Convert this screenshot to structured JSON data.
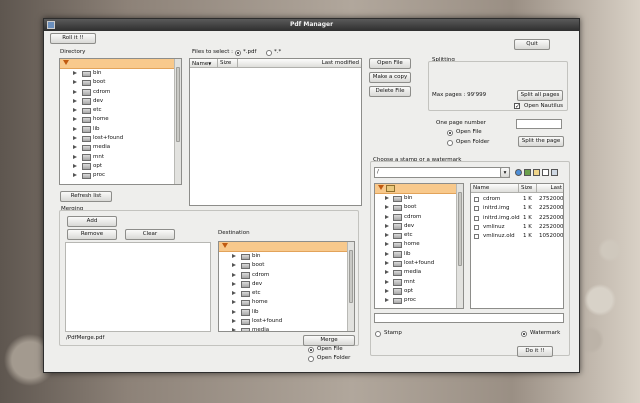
{
  "window": {
    "title": "Pdf Manager"
  },
  "toolbar": {
    "roll_label": "Roll it !!",
    "quit_label": "Quit"
  },
  "directory": {
    "label": "Directory",
    "items": [
      "bin",
      "boot",
      "cdrom",
      "dev",
      "etc",
      "home",
      "lib",
      "lost+found",
      "media",
      "mnt",
      "opt",
      "proc"
    ],
    "refresh_label": "Refresh list"
  },
  "files": {
    "select_label": "Files to select :",
    "options": [
      {
        "label": "*.pdf",
        "selected": true
      },
      {
        "label": "*.*",
        "selected": false
      }
    ],
    "columns": [
      "Name",
      "Size",
      "Last modified"
    ],
    "open_file_label": "Open File",
    "make_copy_label": "Make a copy",
    "delete_file_label": "Delete File"
  },
  "splitting": {
    "label": "Splitting",
    "max_pages": "Max pages : 99'999",
    "split_all_label": "Split all pages",
    "open_nautilus_label": "Open Nautilus",
    "open_nautilus_checked": true,
    "one_page_label": "One page number",
    "page_number_value": "",
    "open_file_label": "Open File",
    "open_folder_label": "Open Folder",
    "split_page_label": "Split the page"
  },
  "merging": {
    "label": "Merging",
    "add_label": "Add",
    "remove_label": "Remove",
    "clear_label": "Clear",
    "output": "/PdfMerge.pdf"
  },
  "destination": {
    "label": "Destination",
    "items": [
      "bin",
      "boot",
      "cdrom",
      "dev",
      "etc",
      "home",
      "lib",
      "lost+found",
      "media"
    ],
    "merge_label": "Merge",
    "open_file_label": "Open File",
    "open_folder_label": "Open Folder"
  },
  "stamp": {
    "label": "Choose a stamp or a watermark",
    "path_value": "/",
    "tree_items": [
      "bin",
      "boot",
      "cdrom",
      "dev",
      "etc",
      "home",
      "lib",
      "lost+found",
      "media",
      "mnt",
      "opt",
      "proc"
    ],
    "columns": [
      "Name",
      "Size",
      "Last"
    ],
    "files": [
      {
        "name": "cdrom",
        "size": "1 K",
        "modified": "2752000"
      },
      {
        "name": "initrd.img",
        "size": "1 K",
        "modified": "2252000"
      },
      {
        "name": "initrd.img.old",
        "size": "1 K",
        "modified": "2252000"
      },
      {
        "name": "vmlinuz",
        "size": "1 K",
        "modified": "2252000"
      },
      {
        "name": "vmlinuz.old",
        "size": "1 K",
        "modified": "1052000"
      }
    ],
    "file_name_value": "",
    "stamp_label": "Stamp",
    "watermark_label": "Watermark",
    "do_it_label": "Do it !!"
  }
}
